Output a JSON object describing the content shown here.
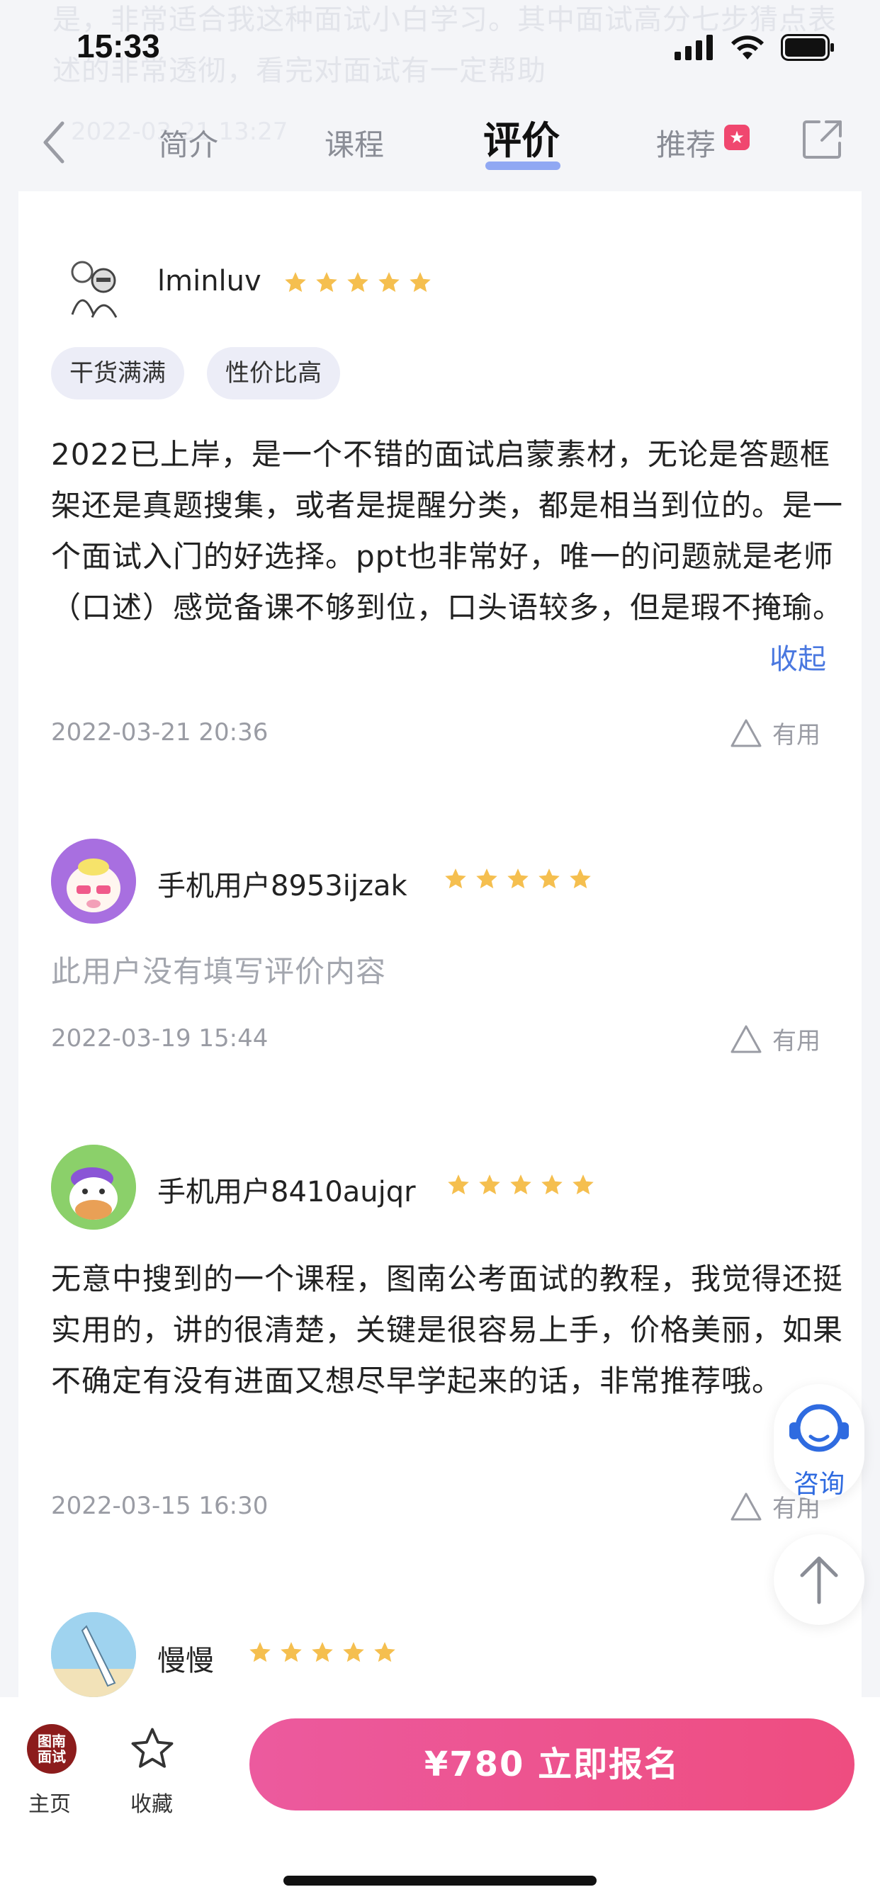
{
  "status_bar": {
    "time": "15:33"
  },
  "header_overlap": {
    "text": "是，非常适合我这种面试小白学习。其中面试高分七步猜点表述的非常透彻，看完对面试有一定帮助",
    "date": "2022-03-21 13:27"
  },
  "nav": {
    "tabs": [
      "简介",
      "课程",
      "评价",
      "推荐"
    ],
    "active_tab": "评价",
    "rec_badge": "★"
  },
  "reviews": [
    {
      "username": "lminluv",
      "rating": 5,
      "tags": [
        "干货满满",
        "性价比高"
      ],
      "text": "2022已上岸，是一个不错的面试启蒙素材，无论是答题框架还是真题搜集，或者是提醒分类，都是相当到位的。是一个面试入门的好选择。ppt也非常好，唯一的问题就是老师（口述）感觉备课不够到位，口头语较多，但是瑕不掩瑜。",
      "collapse_label": "收起",
      "date": "2022-03-21 20:36",
      "useful_label": "有用"
    },
    {
      "username": "手机用户8953ijzak",
      "rating": 5,
      "text": "此用户没有填写评价内容",
      "date": "2022-03-19 15:44",
      "useful_label": "有用"
    },
    {
      "username": "手机用户8410aujqr",
      "rating": 5,
      "text": "无意中搜到的一个课程，图南公考面试的教程，我觉得还挺实用的，讲的很清楚，关键是很容易上手，价格美丽，如果不确定有没有进面又想尽早学起来的话，非常推荐哦。",
      "date": "2022-03-15 16:30",
      "useful_label": "有用"
    },
    {
      "username": "慢慢",
      "rating": 5
    }
  ],
  "floating": {
    "consult_label": "咨询"
  },
  "bottom_bar": {
    "logo_text_line1": "图南",
    "logo_text_line2": "面试",
    "home_label": "主页",
    "favorite_label": "收藏",
    "enroll_label": "¥780  立即报名"
  },
  "colors": {
    "accent": "#4a78e0",
    "star": "#f5bf4f",
    "enroll": "#ee4d80"
  }
}
